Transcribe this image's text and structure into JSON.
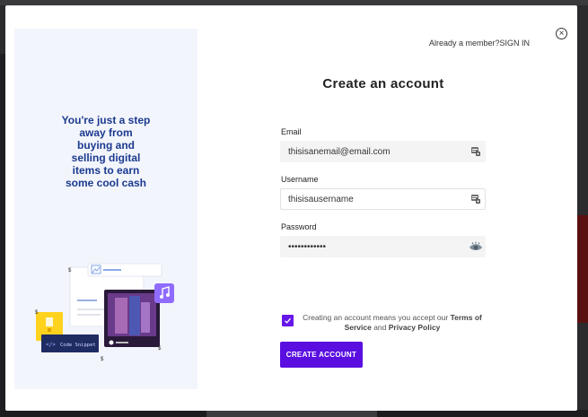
{
  "header": {
    "member_prompt": "Already a member?",
    "sign_in_label": "SIGN IN",
    "close_symbol": "×"
  },
  "promo": {
    "tagline": "You're just a step away from buying and selling digital items to earn some cool cash",
    "snippet_label": "Code Snippet",
    "snippet_tag": "</>",
    "price_symbol": "$"
  },
  "form": {
    "title": "Create an account",
    "email": {
      "label": "Email",
      "value": "thisisanemail@email.com"
    },
    "username": {
      "label": "Username",
      "value": "thisisausername"
    },
    "password": {
      "label": "Password",
      "value": "••••••••••••"
    },
    "terms": {
      "prefix": "Creating an account means you accept our ",
      "terms_link": "Terms of Service",
      "connector": " and ",
      "privacy_link": "Privacy Policy"
    },
    "submit_label": "CREATE ACCOUNT"
  },
  "colors": {
    "accent": "#5a0fe0",
    "tagline": "#1b3a8f",
    "panel_bg": "#f3f5fc"
  }
}
